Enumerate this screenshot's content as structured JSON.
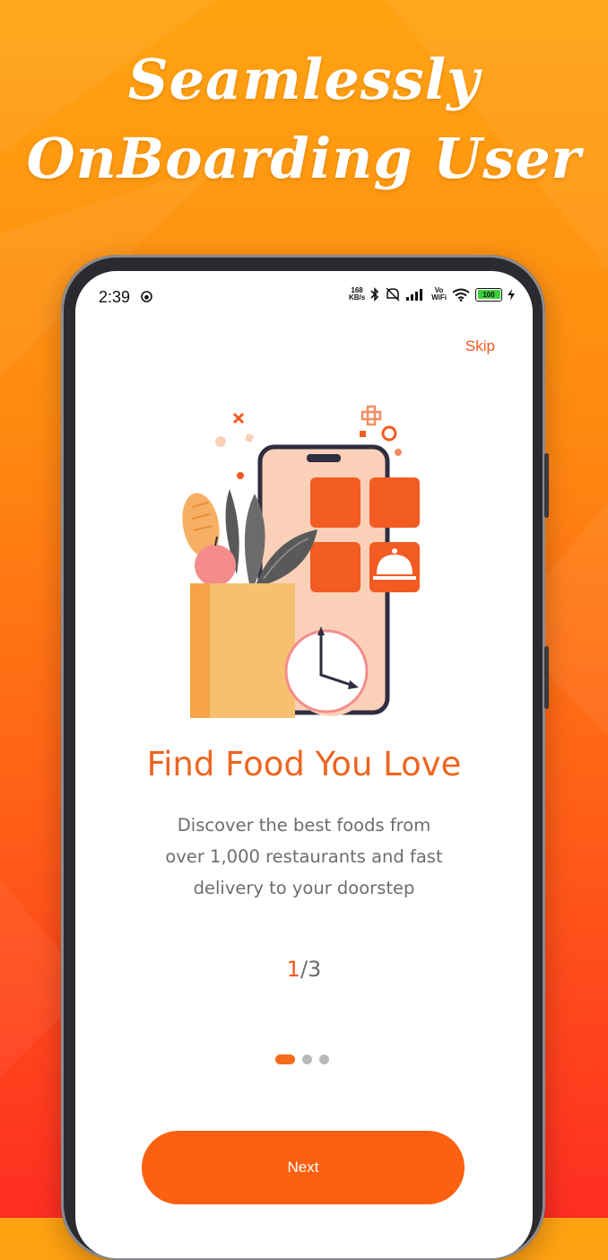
{
  "promo": {
    "line1": "Seamlessly",
    "line2": "OnBoarding User"
  },
  "status_bar": {
    "time": "2:39",
    "speed_value": "168",
    "speed_unit": "KB/s",
    "vowifi_top": "Vo",
    "vowifi_bottom": "WiFi",
    "battery": "100",
    "icons": [
      "face-icon",
      "bluetooth-icon",
      "mute-icon",
      "signal-icon",
      "wifi-icon",
      "battery-icon",
      "charging-icon"
    ]
  },
  "onboarding": {
    "skip_label": "Skip",
    "title": "Find Food You Love",
    "description_lines": [
      "Discover the best foods from",
      "over 1,000 restaurants and fast",
      "delivery to your doorstep"
    ],
    "page_current": "1",
    "page_rest": "/3",
    "dots_total": 3,
    "dots_active_index": 0,
    "next_label": "Next"
  },
  "colors": {
    "accent": "#fc6011",
    "title": "#ee6520",
    "body_text": "#6d6d6d",
    "background_top": "#ffa312",
    "background_bottom": "#ff2d22"
  }
}
